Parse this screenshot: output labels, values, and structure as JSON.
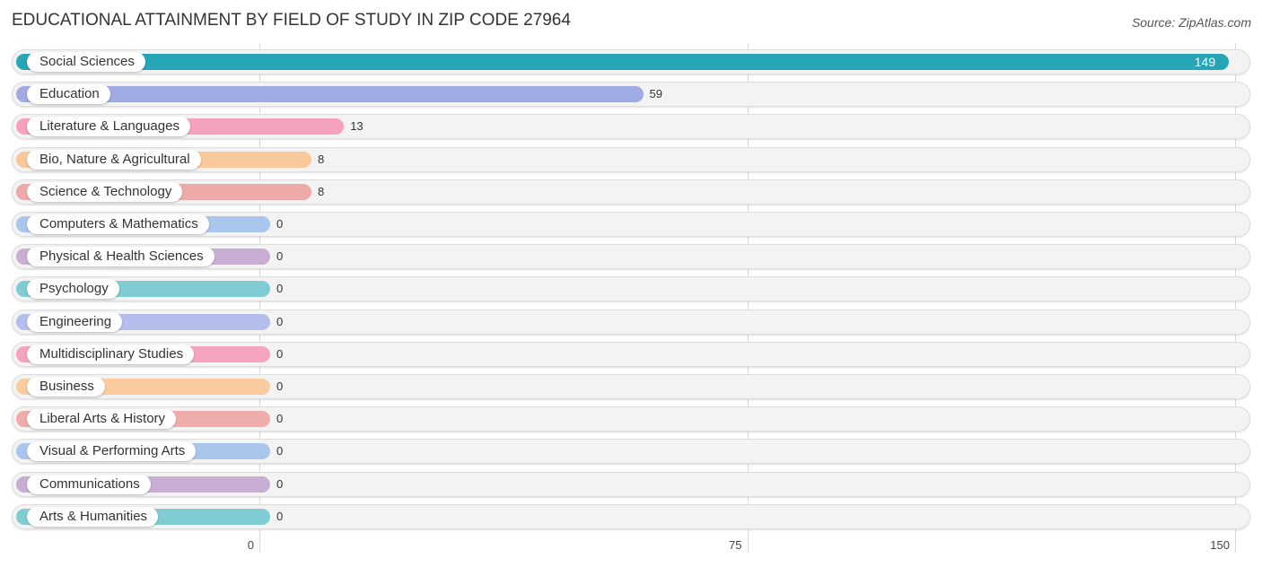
{
  "header": {
    "title": "EDUCATIONAL ATTAINMENT BY FIELD OF STUDY IN ZIP CODE 27964",
    "source": "Source: ZipAtlas.com"
  },
  "chart_data": {
    "type": "bar",
    "orientation": "horizontal",
    "title": "EDUCATIONAL ATTAINMENT BY FIELD OF STUDY IN ZIP CODE 27964",
    "xlabel": "",
    "ylabel": "",
    "xlim": [
      0,
      150
    ],
    "ticks": [
      0,
      75,
      150
    ],
    "tick_labels": [
      "0",
      "75",
      "150"
    ],
    "grid": true,
    "categories": [
      "Social Sciences",
      "Education",
      "Literature & Languages",
      "Bio, Nature & Agricultural",
      "Science & Technology",
      "Computers & Mathematics",
      "Physical & Health Sciences",
      "Psychology",
      "Engineering",
      "Multidisciplinary Studies",
      "Business",
      "Liberal Arts & History",
      "Visual & Performing Arts",
      "Communications",
      "Arts & Humanities"
    ],
    "values": [
      149,
      59,
      13,
      8,
      8,
      0,
      0,
      0,
      0,
      0,
      0,
      0,
      0,
      0,
      0
    ],
    "value_labels": [
      "149",
      "59",
      "13",
      "8",
      "8",
      "0",
      "0",
      "0",
      "0",
      "0",
      "0",
      "0",
      "0",
      "0",
      "0"
    ],
    "colors": [
      "#26a5b6",
      "#a1abe3",
      "#f5a2bd",
      "#f9c99c",
      "#eeaaa8",
      "#a9c6ec",
      "#c9aed3",
      "#80ccd3",
      "#b5bdec",
      "#f5a4bf",
      "#f9cb9e",
      "#eeadab",
      "#a9c6ec",
      "#c9aed3",
      "#80ccd3"
    ]
  }
}
